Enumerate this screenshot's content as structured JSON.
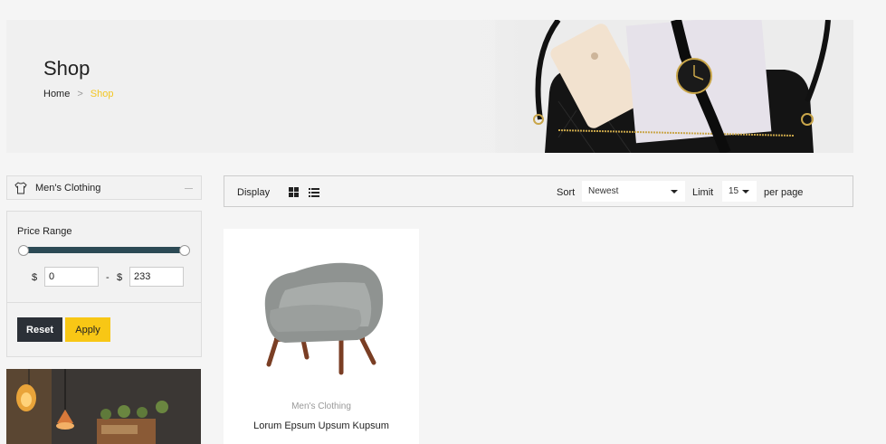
{
  "banner": {
    "title": "Shop",
    "breadcrumb": {
      "home": "Home",
      "separator": ">",
      "current": "Shop"
    }
  },
  "sidebar": {
    "category": {
      "icon": "shirt-icon",
      "label": "Men's Clothing"
    },
    "price_range": {
      "title": "Price Range",
      "currency": "$",
      "range_separator": "-",
      "min_value": "0",
      "max_value": "233",
      "slider_min_fraction": 0,
      "slider_max_fraction": 1
    },
    "buttons": {
      "reset": "Reset",
      "apply": "Apply"
    }
  },
  "toolbar": {
    "display_label": "Display",
    "view_icons": [
      "grid-view-icon",
      "list-view-icon"
    ],
    "sort_label": "Sort",
    "sort_value": "Newest",
    "limit_label": "Limit",
    "limit_value": "15",
    "per_page_label": "per page"
  },
  "products": [
    {
      "category": "Men's Clothing",
      "name": "Lorum Epsum Upsum Kupsum",
      "image": "armchair"
    }
  ],
  "colors": {
    "accent": "#f3c623",
    "apply_button": "#f8c715",
    "reset_button": "#2b3037",
    "slider_track": "#2c4a55",
    "background": "#f5f5f5"
  }
}
